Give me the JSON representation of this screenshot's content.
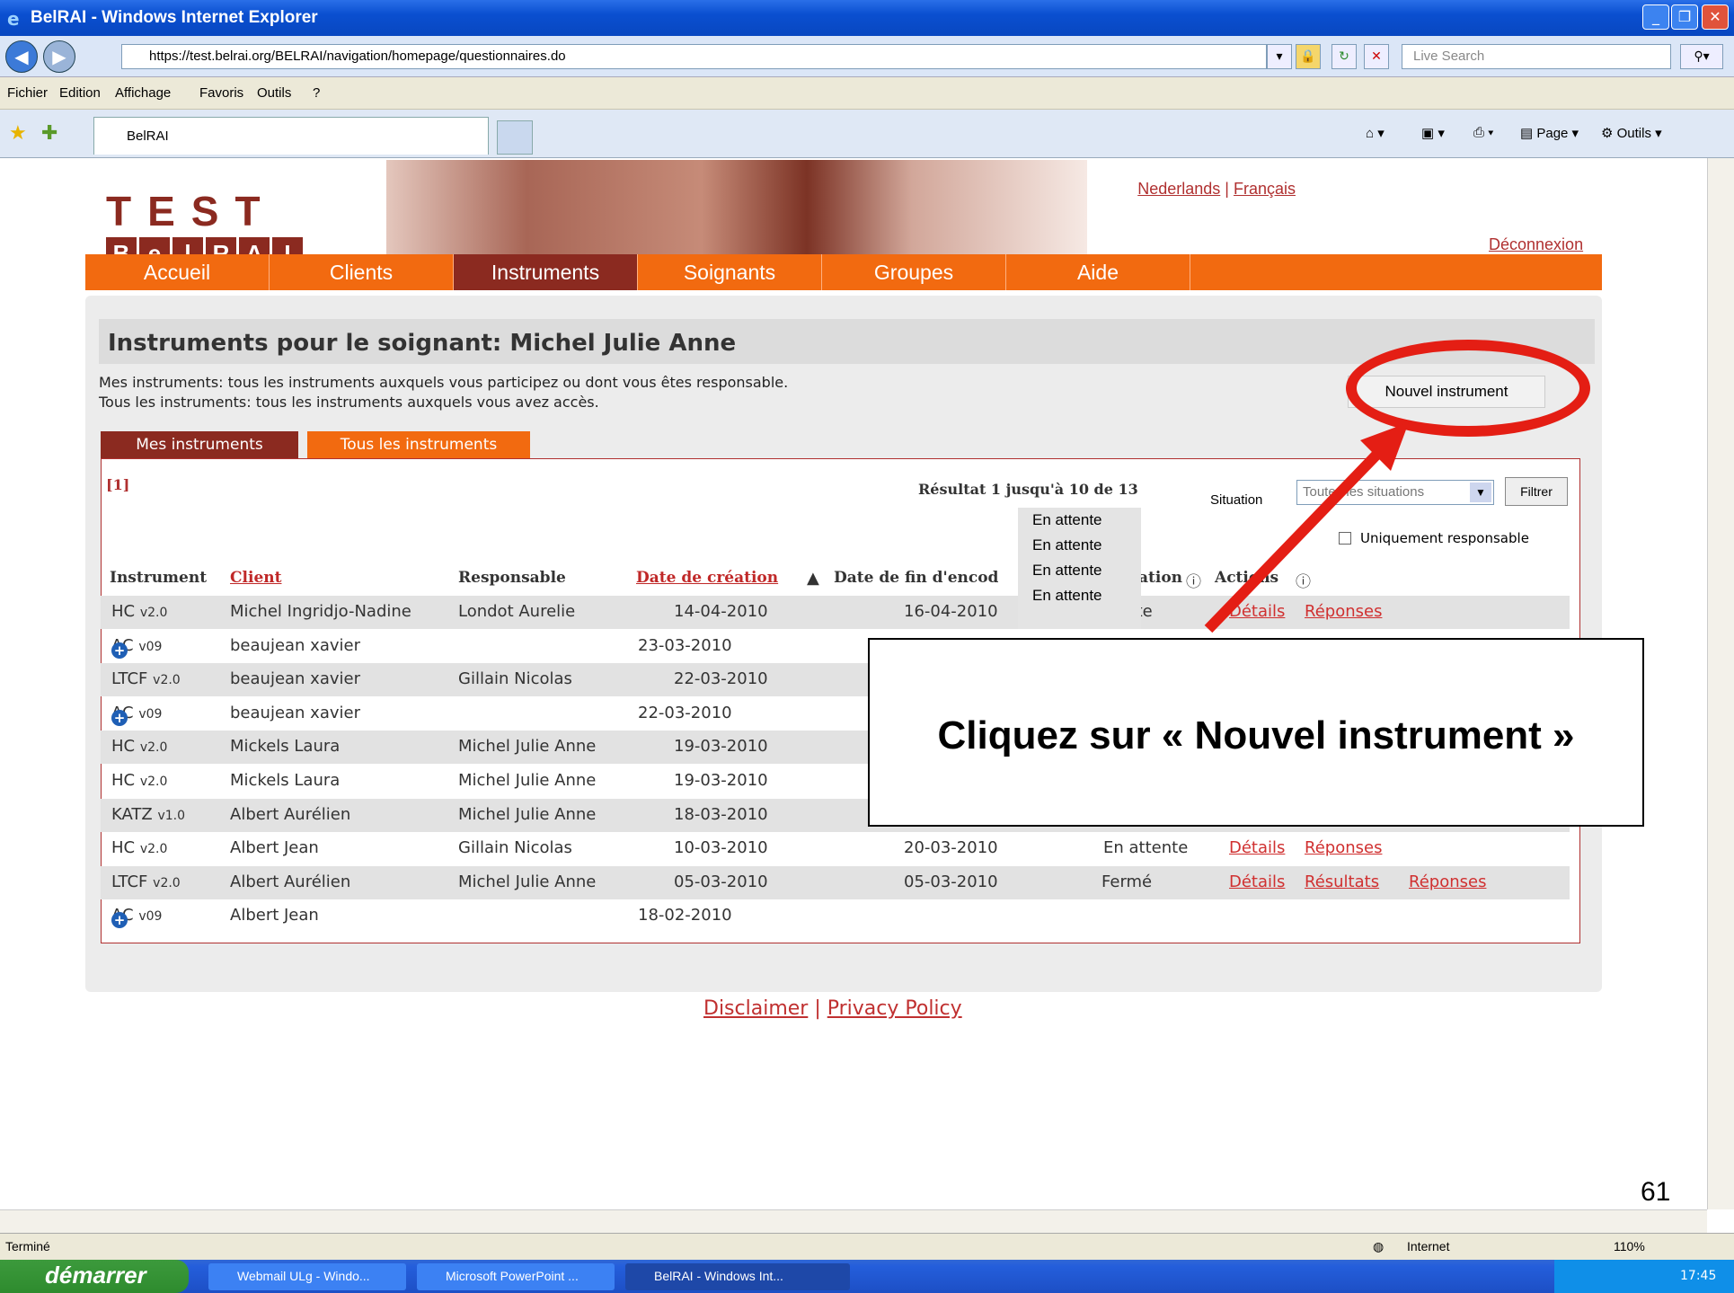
{
  "browser": {
    "title": "BelRAI - Windows Internet Explorer",
    "url": "https://test.belrai.org/BELRAI/navigation/homepage/questionnaires.do",
    "search_placeholder": "Live Search",
    "menu": [
      "Fichier",
      "Edition",
      "Affichage",
      "Favoris",
      "Outils",
      "?"
    ],
    "tab_label": "BelRAI",
    "tools": {
      "page": "Page",
      "outils": "Outils"
    },
    "status": "Terminé",
    "zone": "Internet",
    "zoom": "110%"
  },
  "taskbar": {
    "start": "démarrer",
    "items": [
      "Webmail ULg - Windo...",
      "Microsoft PowerPoint ...",
      "BelRAI - Windows Int..."
    ],
    "clock": "17:45"
  },
  "site": {
    "logo_test": "TEST",
    "logo_letters": [
      "B",
      "e",
      "l",
      "R",
      "A",
      "I"
    ],
    "lang_nl": "Nederlands",
    "lang_sep": " | ",
    "lang_fr": "Français",
    "logout": "Déconnexion",
    "nav": [
      "Accueil",
      "Clients",
      "Instruments",
      "Soignants",
      "Groupes",
      "Aide"
    ],
    "heading": "Instruments pour le soignant: Michel Julie Anne",
    "desc1": "Mes instruments: tous les instruments auxquels vous participez ou dont vous êtes responsable.",
    "desc2": "Tous les instruments: tous les instruments auxquels vous avez accès.",
    "new_button": "Nouvel instrument",
    "tab_mine": "Mes instruments",
    "tab_all": "Tous les instruments",
    "pager": "[1]",
    "result": "Résultat 1 jusqu'à 10 de 13",
    "situation_label": "Situation",
    "situation_value": "Toutes les situations",
    "filter": "Filtrer",
    "only_resp": "Uniquement responsable",
    "dropdown": [
      "En attente",
      "En attente",
      "En attente",
      "En attente"
    ],
    "columns": {
      "instrument": "Instrument",
      "client": "Client",
      "resp": "Responsable",
      "date": "Date de création",
      "date_sort": "▲",
      "enddate": "Date de fin d'encod",
      "situation": "ation",
      "actions": "Actions"
    },
    "rows": [
      {
        "instr": "HC",
        "ver": "v2.0",
        "plus": false,
        "client": "Michel Ingridjo-Nadine",
        "resp": "Londot Aurelie",
        "date": "14-04-2010",
        "end": "16-04-2010",
        "sit": "ttente",
        "a1": "Détails",
        "a2": "Réponses",
        "a3": ""
      },
      {
        "instr": "AC",
        "ver": "v09",
        "plus": true,
        "client": "beaujean xavier",
        "resp": "",
        "date": "23-03-2010",
        "end": "",
        "sit": "",
        "a1": "",
        "a2": "",
        "a3": ""
      },
      {
        "instr": "LTCF",
        "ver": "v2.0",
        "plus": false,
        "client": "beaujean xavier",
        "resp": "Gillain Nicolas",
        "date": "22-03-2010",
        "end": "",
        "sit": "",
        "a1": "",
        "a2": "",
        "a3": ""
      },
      {
        "instr": "AC",
        "ver": "v09",
        "plus": true,
        "client": "beaujean xavier",
        "resp": "",
        "date": "22-03-2010",
        "end": "",
        "sit": "",
        "a1": "",
        "a2": "",
        "a3": ""
      },
      {
        "instr": "HC",
        "ver": "v2.0",
        "plus": false,
        "client": "Mickels Laura",
        "resp": "Michel Julie Anne",
        "date": "19-03-2010",
        "end": "",
        "sit": "",
        "a1": "",
        "a2": "",
        "a3": ""
      },
      {
        "instr": "HC",
        "ver": "v2.0",
        "plus": false,
        "client": "Mickels Laura",
        "resp": "Michel Julie Anne",
        "date": "19-03-2010",
        "end": "",
        "sit": "",
        "a1": "",
        "a2": "",
        "a3": ""
      },
      {
        "instr": "KATZ",
        "ver": "v1.0",
        "plus": false,
        "client": "Albert Aurélien",
        "resp": "Michel Julie Anne",
        "date": "18-03-2010",
        "end": "",
        "sit": "",
        "a1": "",
        "a2": "",
        "a3": ""
      },
      {
        "instr": "HC",
        "ver": "v2.0",
        "plus": false,
        "client": "Albert Jean",
        "resp": "Gillain Nicolas",
        "date": "10-03-2010",
        "end": "20-03-2010",
        "sit": "En attente",
        "a1": "Détails",
        "a2": "Réponses",
        "a3": ""
      },
      {
        "instr": "LTCF",
        "ver": "v2.0",
        "plus": false,
        "client": "Albert Aurélien",
        "resp": "Michel Julie Anne",
        "date": "05-03-2010",
        "end": "05-03-2010",
        "sit": "Fermé",
        "a1": "Détails",
        "a2": "Résultats",
        "a3": "Réponses"
      },
      {
        "instr": "AC",
        "ver": "v09",
        "plus": true,
        "client": "Albert Jean",
        "resp": "",
        "date": "18-02-2010",
        "end": "",
        "sit": "",
        "a1": "",
        "a2": "",
        "a3": ""
      }
    ],
    "footer_disclaimer": "Disclaimer",
    "footer_sep": " | ",
    "footer_privacy": "Privacy Policy"
  },
  "annotation": {
    "callout": "Cliquez sur « Nouvel instrument »",
    "page_number": "61",
    "highlight_color": "#e41e14"
  }
}
